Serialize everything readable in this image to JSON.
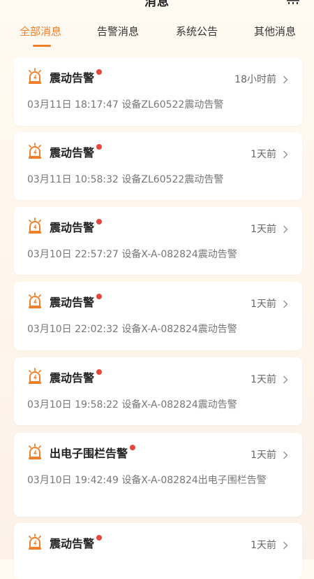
{
  "header": {
    "title": "消息"
  },
  "tabs": [
    {
      "label": "全部消息",
      "active": true
    },
    {
      "label": "告警消息",
      "active": false
    },
    {
      "label": "系统公告",
      "active": false
    },
    {
      "label": "其他消息",
      "active": false
    }
  ],
  "colors": {
    "accent": "#f07f2a",
    "unread_dot": "#e8483c",
    "alarm_icon": "#f07f2a"
  },
  "messages": [
    {
      "title": "震动告警",
      "unread": true,
      "time": "18小时前",
      "desc": "03月11日 18:17:47 设备ZL60522震动告警"
    },
    {
      "title": "震动告警",
      "unread": true,
      "time": "1天前",
      "desc": "03月11日 10:58:32 设备ZL60522震动告警"
    },
    {
      "title": "震动告警",
      "unread": true,
      "time": "1天前",
      "desc": "03月10日 22:57:27 设备X-A-082824震动告警"
    },
    {
      "title": "震动告警",
      "unread": true,
      "time": "1天前",
      "desc": "03月10日 22:02:32 设备X-A-082824震动告警"
    },
    {
      "title": "震动告警",
      "unread": true,
      "time": "1天前",
      "desc": "03月10日 19:58:22 设备X-A-082824震动告警"
    },
    {
      "title": "出电子围栏告警",
      "unread": true,
      "time": "1天前",
      "desc": "03月10日 19:42:49 设备X-A-082824出电子围栏告警"
    },
    {
      "title": "震动告警",
      "unread": true,
      "time": "1天前",
      "desc": ""
    }
  ],
  "icons": {
    "message_icon": "alarm-siren-icon",
    "row_arrow": "chevron-right-icon",
    "header_menu": "menu-icon"
  }
}
